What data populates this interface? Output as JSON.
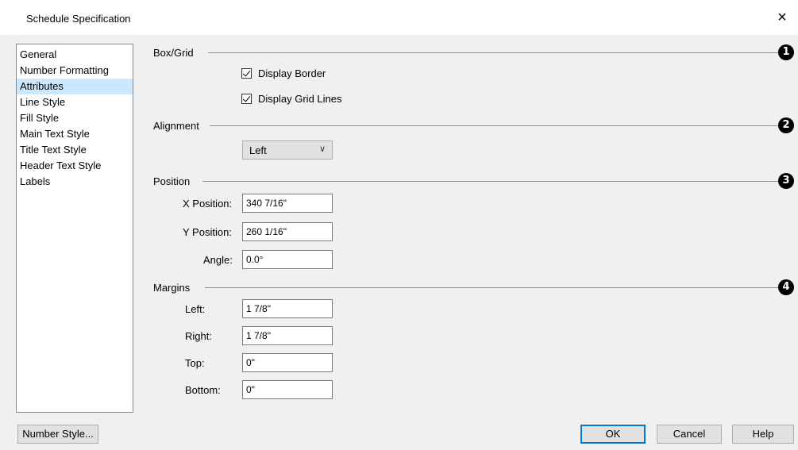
{
  "window": {
    "title": "Schedule Specification",
    "close_glyph": "×"
  },
  "sidebar": {
    "items": [
      {
        "label": "General"
      },
      {
        "label": "Number Formatting"
      },
      {
        "label": "Attributes",
        "selected": true
      },
      {
        "label": "Line Style"
      },
      {
        "label": "Fill Style"
      },
      {
        "label": "Main Text Style"
      },
      {
        "label": "Title Text Style"
      },
      {
        "label": "Header Text Style"
      },
      {
        "label": "Labels"
      }
    ]
  },
  "box_grid": {
    "heading": "Box/Grid",
    "badge": "1",
    "display_border": {
      "label": "Display Border",
      "checked": true
    },
    "display_grid_lines": {
      "label": "Display Grid Lines",
      "checked": true
    }
  },
  "alignment": {
    "heading": "Alignment",
    "badge": "2",
    "value": "Left"
  },
  "position": {
    "heading": "Position",
    "badge": "3",
    "x_label": "X Position:",
    "x_value": "340 7/16\"",
    "y_label": "Y Position:",
    "y_value": "260 1/16\"",
    "angle_label": "Angle:",
    "angle_value": "0.0°"
  },
  "margins": {
    "heading": "Margins",
    "badge": "4",
    "left_label": "Left:",
    "left_value": "1 7/8\"",
    "right_label": "Right:",
    "right_value": "1 7/8\"",
    "top_label": "Top:",
    "top_value": "0\"",
    "bottom_label": "Bottom:",
    "bottom_value": "0\""
  },
  "footer": {
    "number_style_label": "Number Style...",
    "ok_label": "OK",
    "cancel_label": "Cancel",
    "help_label": "Help"
  },
  "colors": {
    "selection": "#cce8ff",
    "default_button_border": "#0078d7"
  }
}
